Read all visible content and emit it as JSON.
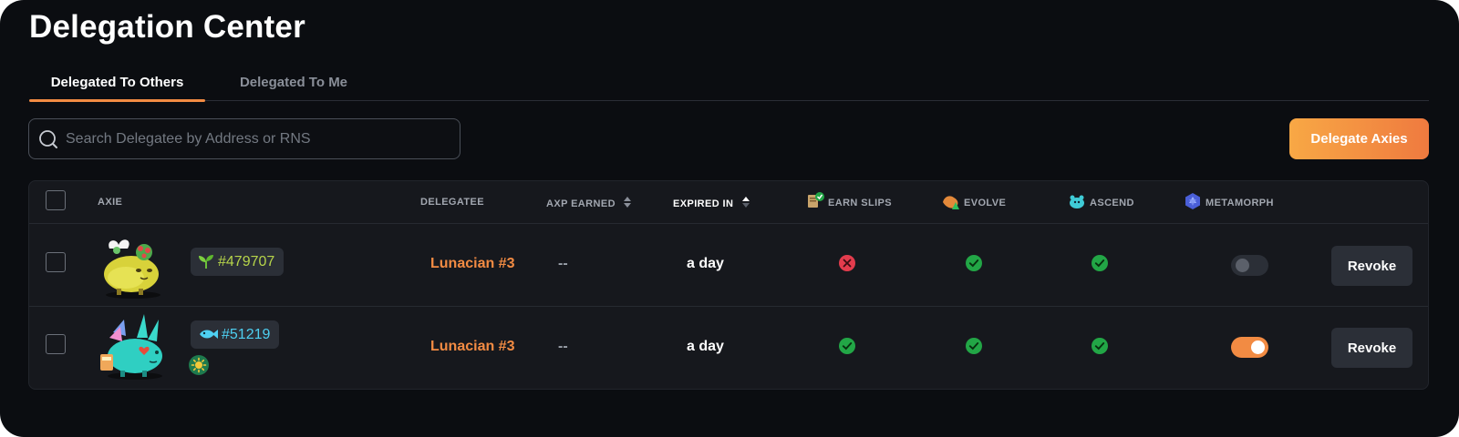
{
  "page": {
    "title": "Delegation Center"
  },
  "tabs": [
    {
      "label": "Delegated To Others",
      "active": true
    },
    {
      "label": "Delegated To Me",
      "active": false
    }
  ],
  "search": {
    "placeholder": "Search Delegatee by Address or RNS",
    "value": ""
  },
  "actions": {
    "delegate_label": "Delegate Axies"
  },
  "table": {
    "columns": {
      "axie": "Axie",
      "delegatee": "Delegatee",
      "axp_earned": "AXP Earned",
      "expired_in": "Expired In",
      "earn_slips": "Earn Slips",
      "evolve": "Evolve",
      "ascend": "Ascend",
      "metamorph": "Metamorph"
    },
    "rows": [
      {
        "axie_id": "#479707",
        "axie_class_icon": "plant-sprout-icon",
        "delegatee": "Lunacian #3",
        "axp_earned": "--",
        "expired_in": "a day",
        "earn_slips": "denied",
        "evolve": "allowed",
        "ascend": "allowed",
        "metamorph": false,
        "revoke_label": "Revoke"
      },
      {
        "axie_id": "#51219",
        "axie_class_icon": "aquatic-fish-icon",
        "extra_badge": "sun-badge-icon",
        "delegatee": "Lunacian #3",
        "axp_earned": "--",
        "expired_in": "a day",
        "earn_slips": "allowed",
        "evolve": "allowed",
        "ascend": "allowed",
        "metamorph": true,
        "revoke_label": "Revoke"
      }
    ]
  },
  "colors": {
    "background": "#0b0d11",
    "accent": "#f28b43",
    "allowed": "#22a646",
    "denied": "#e33c4d"
  }
}
